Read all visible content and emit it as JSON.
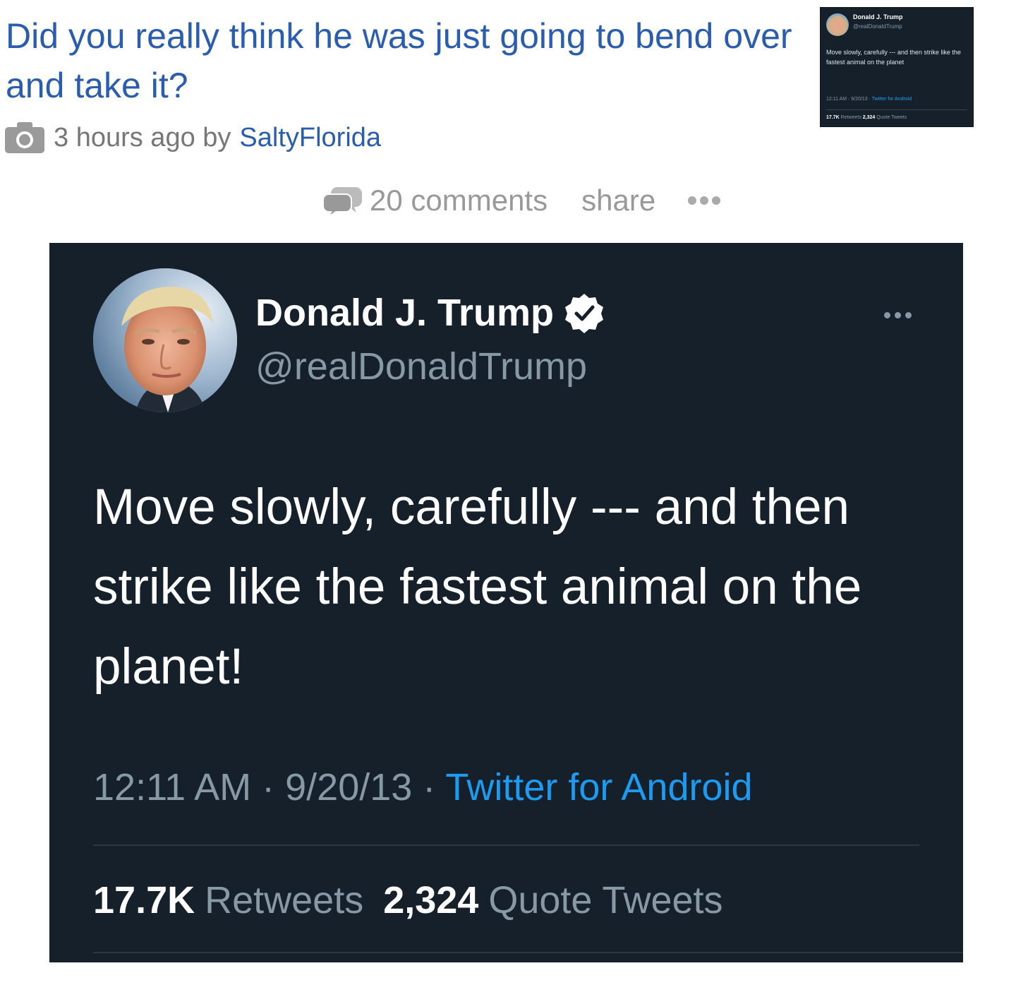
{
  "post": {
    "title": "Did you really think he was just going to bend over and take it?",
    "time_ago": "3 hours ago by",
    "author": "SaltyFlorida",
    "comments_label": "20 comments",
    "share_label": "share"
  },
  "thumbnail": {
    "name": "Donald J. Trump",
    "handle": "@realDonaldTrump",
    "text": "Move slowly, carefully --- and then strike like the fastest animal on the planet",
    "time": "12:11 AM · 9/20/13 · ",
    "source": "Twitter for Android",
    "retweets_count": "17.7K",
    "retweets_label": "Retweets",
    "quotes_count": "2,324",
    "quotes_label": "Quote Tweets"
  },
  "tweet": {
    "name": "Donald J. Trump",
    "handle": "@realDonaldTrump",
    "text": "Move slowly, carefully --- and then strike like the fastest animal on the planet!",
    "timestamp": "12:11 AM · 9/20/13 · ",
    "source": "Twitter for Android",
    "retweets_count": "17.7K",
    "retweets_label": "Retweets",
    "quotes_count": "2,324",
    "quotes_label": "Quote Tweets"
  },
  "colors": {
    "link_blue": "#2a5db0",
    "tweet_bg": "#15202b",
    "twitter_blue": "#1d9bf0",
    "muted": "#8899a6"
  }
}
